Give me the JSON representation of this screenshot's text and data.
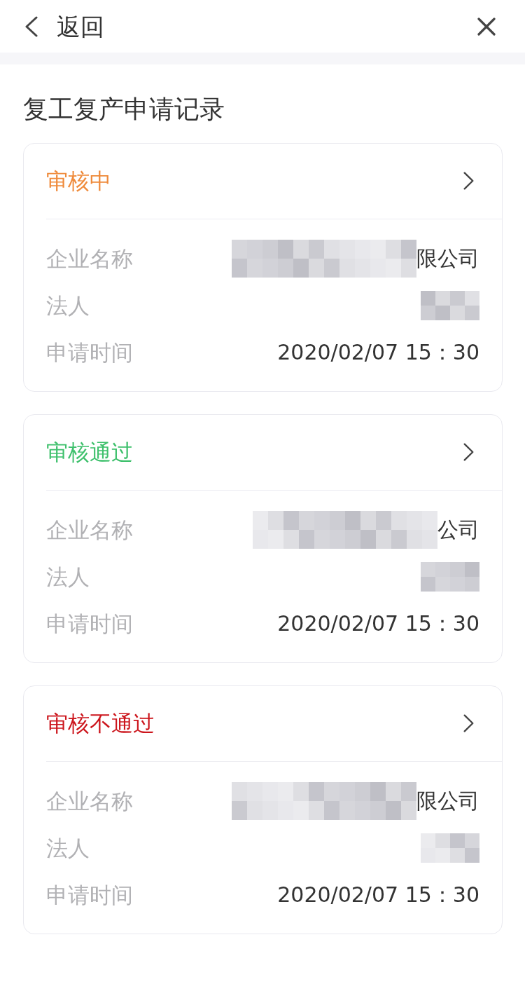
{
  "nav": {
    "back_label": "返回"
  },
  "title": "复工复产申请记录",
  "records": [
    {
      "status": "审核中",
      "color": "#ef8a3a",
      "fields": [
        {
          "label": "企业名称",
          "value": "限公司",
          "redacted": true
        },
        {
          "label": "法人",
          "redacted": true
        },
        {
          "label": "申请时间",
          "value": "2020/02/07 15：30",
          "redacted": false
        }
      ]
    },
    {
      "status": "审核通过",
      "color": "#3ec06c",
      "fields": [
        {
          "label": "企业名称",
          "value": "公司",
          "redacted": true
        },
        {
          "label": "法人",
          "redacted": true
        },
        {
          "label": "申请时间",
          "value": "2020/02/07 15：30",
          "redacted": false
        }
      ]
    },
    {
      "status": "审核不通过",
      "color": "#cc151c",
      "fields": [
        {
          "label": "企业名称",
          "value": "限公司",
          "redacted": true
        },
        {
          "label": "法人",
          "redacted": true
        },
        {
          "label": "申请时间",
          "value": "2020/02/07 15：30",
          "redacted": false
        }
      ]
    }
  ]
}
